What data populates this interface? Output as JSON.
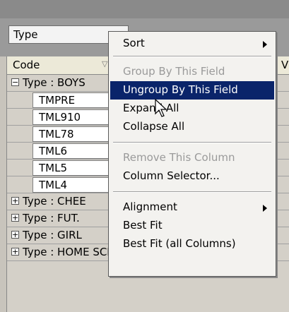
{
  "group_panel": {
    "group_chip_label": "Type"
  },
  "grid": {
    "columns": [
      {
        "label": "Code"
      },
      {
        "label": "V"
      }
    ],
    "rows": [
      {
        "kind": "group",
        "expanded": true,
        "text": "Type : BOYS"
      },
      {
        "kind": "data",
        "code": "TMPRE"
      },
      {
        "kind": "data",
        "code": "TML910"
      },
      {
        "kind": "data",
        "code": "TML78"
      },
      {
        "kind": "data",
        "code": "TML6"
      },
      {
        "kind": "data",
        "code": "TML5"
      },
      {
        "kind": "data",
        "code": "TML4"
      },
      {
        "kind": "group",
        "expanded": false,
        "text": "Type : CHEE"
      },
      {
        "kind": "group",
        "expanded": false,
        "text": "Type : FUT."
      },
      {
        "kind": "group",
        "expanded": false,
        "text": "Type : GIRL"
      },
      {
        "kind": "group",
        "expanded": false,
        "text": "Type : HOME SCHOO"
      }
    ]
  },
  "context_menu": {
    "items": [
      {
        "label": "Sort",
        "submenu": true,
        "disabled": false
      },
      {
        "label": "Group By This Field",
        "disabled": true
      },
      {
        "label": "Ungroup By This Field",
        "highlighted": true
      },
      {
        "label": "Expand All"
      },
      {
        "label": "Collapse All"
      },
      {
        "label": "Remove This Column",
        "disabled": true
      },
      {
        "label": "Column Selector..."
      },
      {
        "label": "Alignment",
        "submenu": true
      },
      {
        "label": "Best Fit"
      },
      {
        "label": "Best Fit (all Columns)"
      }
    ]
  },
  "colors": {
    "highlight": "#0a246a",
    "menu_bg": "#f3f2ef",
    "disabled_text": "#9a9a9a"
  }
}
